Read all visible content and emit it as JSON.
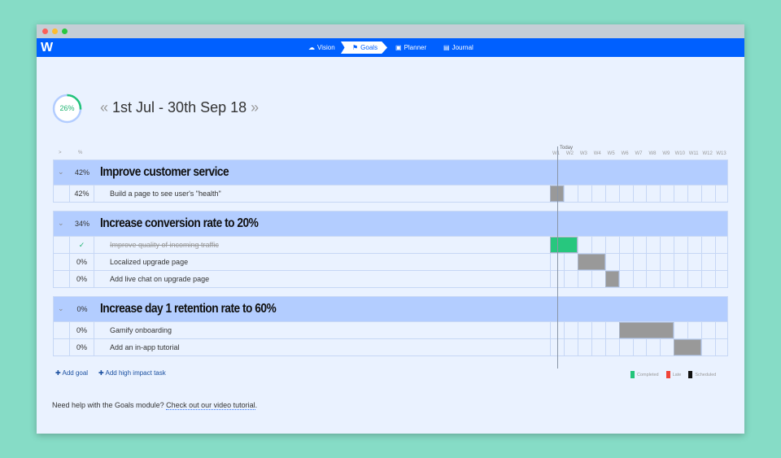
{
  "app": {
    "logo": "W"
  },
  "nav": [
    {
      "label": "Vision",
      "icon": "cloud-icon"
    },
    {
      "label": "Goals",
      "icon": "flag-icon",
      "active": true
    },
    {
      "label": "Planner",
      "icon": "calendar-icon"
    },
    {
      "label": "Journal",
      "icon": "book-icon"
    }
  ],
  "overall": {
    "progress_percent": 26,
    "label": "26%"
  },
  "period": {
    "prev": "«",
    "label": "1st Jul - 30th Sep 18",
    "next": "»"
  },
  "table_header": {
    "expand": ">",
    "pct": "%",
    "today": "Today",
    "weeks": [
      "W1",
      "W2",
      "W3",
      "W4",
      "W5",
      "W6",
      "W7",
      "W8",
      "W9",
      "W10",
      "W11",
      "W12",
      "W13"
    ]
  },
  "today_week": 1.6,
  "goals": [
    {
      "pct": "42%",
      "title": "Improve customer service",
      "tasks": [
        {
          "pct": "42%",
          "name": "Build a page to see user's \"health\"",
          "start": 1,
          "end": 1,
          "status": "scheduled"
        }
      ]
    },
    {
      "pct": "34%",
      "title": "Increase conversion rate to 20%",
      "tasks": [
        {
          "pct": "✓",
          "name": "Improve quality of incoming traffic",
          "done": true,
          "start": 1,
          "end": 2,
          "status": "completed"
        },
        {
          "pct": "0%",
          "name": "Localized upgrade page",
          "start": 3,
          "end": 4,
          "status": "scheduled"
        },
        {
          "pct": "0%",
          "name": "Add live chat on upgrade page",
          "start": 5,
          "end": 5,
          "status": "scheduled"
        }
      ]
    },
    {
      "pct": "0%",
      "title": "Increase day 1 retention rate to 60%",
      "tasks": [
        {
          "pct": "0%",
          "name": "Gamify onboarding",
          "start": 6,
          "end": 9,
          "status": "scheduled"
        },
        {
          "pct": "0%",
          "name": "Add an in-app tutorial",
          "start": 10,
          "end": 11,
          "status": "scheduled"
        }
      ]
    }
  ],
  "actions": {
    "add_goal": "Add goal",
    "add_task": "Add high impact task"
  },
  "legend": [
    {
      "label": "Completed",
      "color": "#22c47a"
    },
    {
      "label": "Late",
      "color": "#f04438"
    },
    {
      "label": "Scheduled",
      "color": "#111111"
    }
  ],
  "colors": {
    "completed_bar": "#27c77e",
    "scheduled_bar": "#999999",
    "accent": "#0060ff"
  },
  "help": {
    "text": "Need help with the Goals module? ",
    "link": "Check out our video tutorial",
    "end": "."
  }
}
